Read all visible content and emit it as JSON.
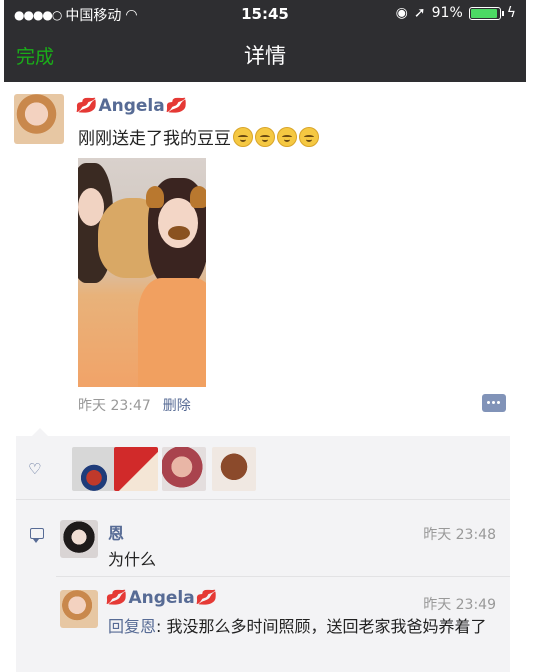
{
  "status": {
    "carrier": "中国移动",
    "time": "15:45",
    "battery": "91%"
  },
  "nav": {
    "done_label": "完成",
    "title": "详情"
  },
  "post": {
    "author": "Angela",
    "text": "刚刚送走了我的豆豆",
    "time": "昨天 23:47",
    "delete_label": "删除"
  },
  "likes": {
    "count": 4
  },
  "comments": [
    {
      "author": "恩",
      "time": "昨天 23:48",
      "text": "为什么"
    },
    {
      "author": "Angela",
      "time": "昨天 23:49",
      "reply_prefix": "回复",
      "reply_target": "恩",
      "text": ": 我没那么多时间照顾，送回老家我爸妈养着了"
    }
  ],
  "colors": {
    "accent_link": "#576b95",
    "done_green": "#1aad19",
    "nav_bg": "#2e2e31"
  }
}
